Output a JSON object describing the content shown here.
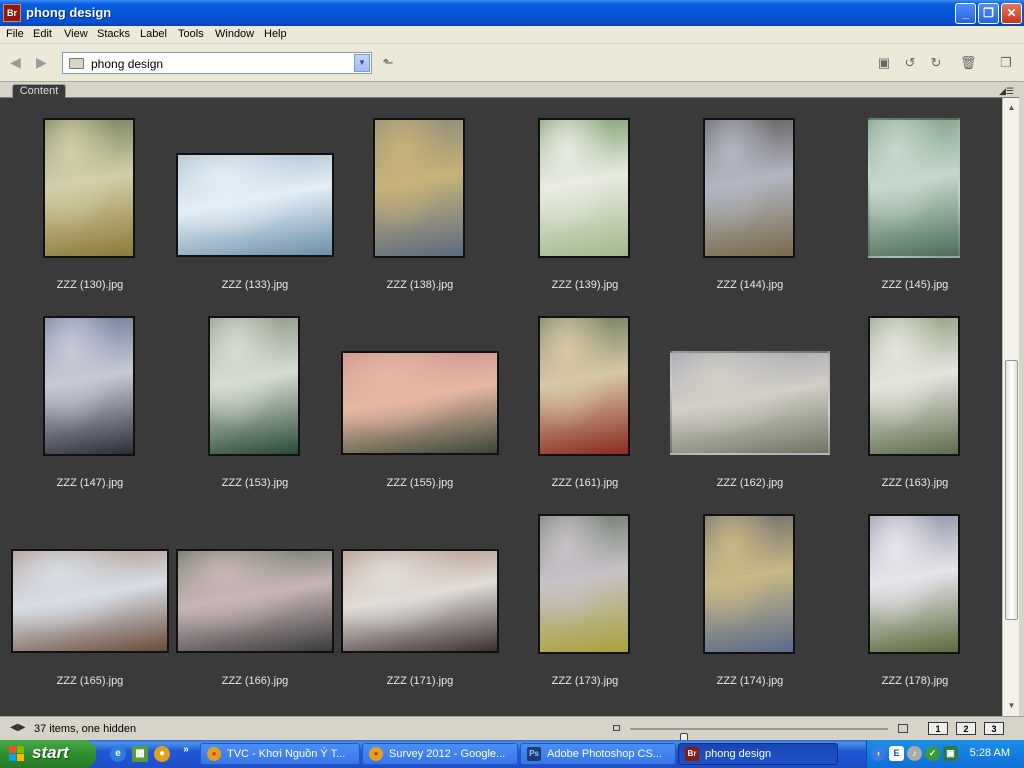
{
  "window": {
    "app_badge": "Br",
    "title": "phong design",
    "minimize": "_",
    "maximize": "❐",
    "close": "✕"
  },
  "menu": [
    "File",
    "Edit",
    "View",
    "Stacks",
    "Label",
    "Tools",
    "Window",
    "Help"
  ],
  "toolbar": {
    "path": "phong design",
    "back_icon": "back-arrow-icon",
    "forward_icon": "forward-arrow-icon"
  },
  "panel": {
    "tab": "Content"
  },
  "thumbnails": [
    {
      "name": "ZZZ (130).jpg",
      "colors": [
        "#6f7d58",
        "#d4cfa8",
        "#8a7a3a"
      ]
    },
    {
      "name": "ZZZ (133).jpg",
      "colors": [
        "#a0b6c8",
        "#e4eef6",
        "#6a8fa8"
      ]
    },
    {
      "name": "ZZZ (138).jpg",
      "colors": [
        "#8a8a78",
        "#c6b27a",
        "#5c6a80"
      ]
    },
    {
      "name": "ZZZ (139).jpg",
      "colors": [
        "#7a9a6a",
        "#e8ece2",
        "#a2b88a"
      ]
    },
    {
      "name": "ZZZ (144).jpg",
      "colors": [
        "#5c5a58",
        "#b2b6c2",
        "#7a6a4a"
      ]
    },
    {
      "name": "ZZZ (145).jpg",
      "colors": [
        "#7e9e86",
        "#c6d8cc",
        "#4e6e58"
      ]
    },
    {
      "name": "ZZZ (147).jpg",
      "colors": [
        "#6a7898",
        "#c8cad6",
        "#2a2e38"
      ]
    },
    {
      "name": "ZZZ (153).jpg",
      "colors": [
        "#8a9482",
        "#d6dcd2",
        "#2a4a36"
      ]
    },
    {
      "name": "ZZZ (155).jpg",
      "colors": [
        "#c88a8a",
        "#e6b8a2",
        "#3a4638"
      ]
    },
    {
      "name": "ZZZ (161).jpg",
      "colors": [
        "#6a7a5a",
        "#d8c8a6",
        "#8a2a20"
      ]
    },
    {
      "name": "ZZZ (162).jpg",
      "colors": [
        "#9a9cae",
        "#d2cfc6",
        "#6e7464"
      ]
    },
    {
      "name": "ZZZ (163).jpg",
      "colors": [
        "#8c9a7a",
        "#e4e6de",
        "#5e6c4c"
      ]
    },
    {
      "name": "ZZZ (165).jpg",
      "colors": [
        "#a88a7a",
        "#d8dee6",
        "#6a4a3a"
      ]
    },
    {
      "name": "ZZZ (166).jpg",
      "colors": [
        "#5a6a58",
        "#c8b6b6",
        "#3a3a3a"
      ]
    },
    {
      "name": "ZZZ (171).jpg",
      "colors": [
        "#a8887a",
        "#e2ddd8",
        "#3a3030"
      ]
    },
    {
      "name": "ZZZ (173).jpg",
      "colors": [
        "#6a7a6a",
        "#c8c2c8",
        "#a8a23a"
      ]
    },
    {
      "name": "ZZZ (174).jpg",
      "colors": [
        "#6a6a6a",
        "#c8b886",
        "#5a6a8a"
      ]
    },
    {
      "name": "ZZZ (178).jpg",
      "colors": [
        "#8a8ea2",
        "#e6e6ec",
        "#5a6a3a"
      ]
    }
  ],
  "statusbar": {
    "items_text": "37 items, one hidden",
    "thumbnail_zoom": 0.2,
    "workspaces": [
      "1",
      "2",
      "3"
    ]
  },
  "taskbar": {
    "start": "start",
    "tasks": [
      {
        "label": "TVC - Khơi Nguồn Ý T...",
        "icon": "chrome-icon",
        "active": false
      },
      {
        "label": "Survey 2012 - Google...",
        "icon": "chrome-icon",
        "active": false
      },
      {
        "label": "Adobe Photoshop CS...",
        "icon": "photoshop-icon",
        "active": false
      },
      {
        "label": "phong design",
        "icon": "bridge-icon",
        "active": true
      }
    ],
    "clock": "5:28 AM"
  }
}
